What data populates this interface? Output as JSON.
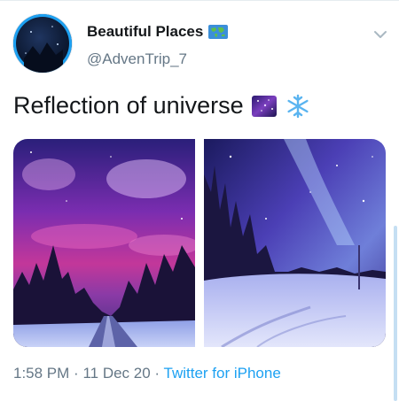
{
  "tweet": {
    "display_name": "Beautiful Places",
    "name_emoji_icon": "world-map-icon",
    "handle": "@AdvenTrip_7",
    "text": "Reflection of universe",
    "text_emojis": [
      "milky-way-icon",
      "snowflake-icon"
    ],
    "images": [
      {
        "name": "purple-sky-snowy-road-photo"
      },
      {
        "name": "milky-way-snowy-forest-photo"
      }
    ],
    "time": "1:58 PM",
    "date": "11 Dec 20",
    "source": "Twitter for iPhone",
    "separator": "·"
  },
  "colors": {
    "accent": "#1da1f2",
    "text_primary": "#14171a",
    "text_secondary": "#657786"
  }
}
